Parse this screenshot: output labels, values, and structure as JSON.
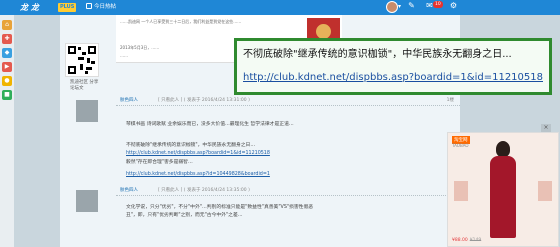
{
  "topbar": {
    "logo": "龙  龙",
    "badge": "PLUS",
    "nav_item": "今日热帖",
    "notification_count": "10"
  },
  "left_rail": {
    "icons": [
      "home-icon",
      "gift-icon",
      "game-icon",
      "video-icon",
      "chat-icon",
      "shop-icon"
    ]
  },
  "article_top": {
    "line1": "……凯迪网 一个人已享受到三十二日后，我们利益是到党在这些……",
    "line2": "2013年5月3日，……",
    "line3": "……"
  },
  "sidebar": {
    "qr_label": "凯迪社区 分享论坛文"
  },
  "posts": [
    {
      "author": "肤色四人",
      "meta": "[ 只看此人 ]  ( 发表于 2016/4/24 13:31:00 )",
      "floor": "1楼",
      "lines": [
        "琴棋书画 诗词歌赋 业余娱乐而已，没多大价值…最理化生 哲学法律才是正道…",
        "",
        "不彻底破除\"继承传统的意识枷锁\"，中华民族永无翻身之日…",
        "http://club.kdnet.net/dispbbs.asp?boardid=1&id=11210518",
        "毅然\"存在即合理\"害多是弱智…",
        "http://club.kdnet.net/dispbbs.asp?id=10449828&boardid=1"
      ],
      "link_indices": [
        3,
        5
      ]
    },
    {
      "author": "肤色四人",
      "meta": "[ 只看此人 ]  ( 发表于 2016/4/24 13:35:00 )",
      "floor": "2楼",
      "lines": [
        "文化学说，只分\"优劣\"，不分\"中外\"…判别的标准只能是\"致益性\"真善美\"VS\"损害性假恶",
        "丑\"，即，只有\"优劣判断\"之别，而无\"古今中外\"之差…"
      ],
      "link_indices": []
    }
  ],
  "tooltip": {
    "title": "不彻底破除\"继承传统的意识枷锁\"，中华民族永无翻身之日...",
    "url": "http://club.kdnet.net/dispbbs.asp?boardid=1&id=11210518"
  },
  "ad": {
    "brand": "淘宝网",
    "sub": "TAOBAO",
    "price": "¥88.00",
    "old_price": "¥149",
    "close_label": "×"
  },
  "colors": {
    "topbar": "#1f87d6",
    "tooltip_border": "#2f8a2f",
    "link": "#1b5ea8"
  }
}
